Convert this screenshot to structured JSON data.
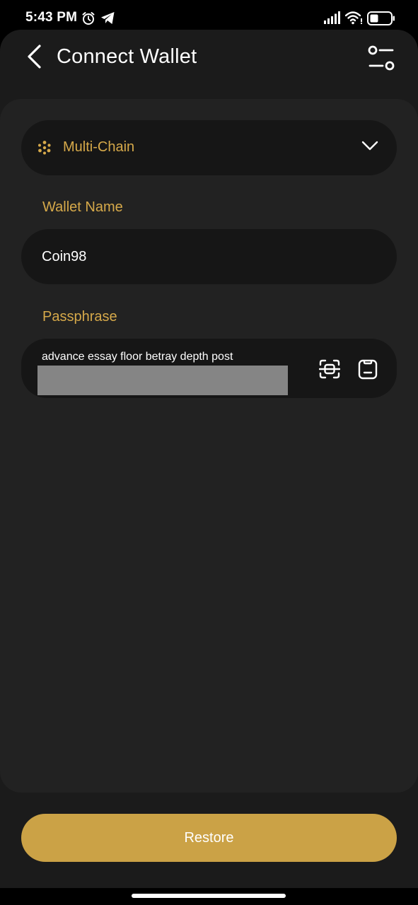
{
  "status_bar": {
    "time": "5:43 PM",
    "icons": [
      "alarm-icon",
      "telegram-icon",
      "signal-icon",
      "wifi-icon",
      "battery-icon"
    ]
  },
  "header": {
    "title": "Connect Wallet",
    "back_icon": "chevron-left-icon",
    "settings_icon": "settings-sliders-icon"
  },
  "chain_select": {
    "selected": "Multi-Chain",
    "icon": "multi-chain-dots-icon"
  },
  "wallet_name": {
    "label": "Wallet Name",
    "value": "Coin98"
  },
  "passphrase": {
    "label": "Passphrase",
    "value": "advance essay floor betray depth post"
  },
  "actions": {
    "restore_label": "Restore"
  },
  "colors": {
    "accent": "#d6a94a",
    "button": "#cba246",
    "card": "#222222",
    "field": "#161616",
    "sheet": "#1b1b1b"
  }
}
